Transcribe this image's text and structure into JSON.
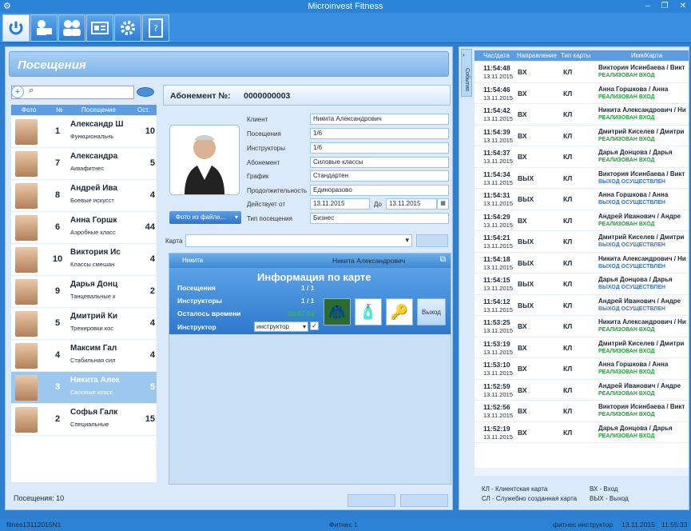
{
  "window": {
    "title": "Microinvest Fitness"
  },
  "toolbar": {
    "buttons": [
      "power-icon",
      "lock-user-icon",
      "users-icon",
      "card-icon",
      "gear-icon",
      "calculator-icon"
    ]
  },
  "section": {
    "title": "Посещения"
  },
  "visits_table": {
    "headers": {
      "photo": "Фото",
      "num": "№",
      "visit": "Посещение",
      "rest": "Ост."
    },
    "rows": [
      {
        "num": "1",
        "name": "Александр Ш",
        "activity": "Функциональнь",
        "count": "10",
        "selected": false
      },
      {
        "num": "7",
        "name": "Александра",
        "activity": "Аквафитнес",
        "count": "5",
        "selected": false
      },
      {
        "num": "8",
        "name": "Андрей Ива",
        "activity": "Боевые искусст",
        "count": "4",
        "selected": false
      },
      {
        "num": "6",
        "name": "Анна Горшк",
        "activity": "Аэробные класс",
        "count": "44",
        "selected": false
      },
      {
        "num": "10",
        "name": "Виктория Ис",
        "activity": "Классы смешан",
        "count": "4",
        "selected": false
      },
      {
        "num": "9",
        "name": "Дарья Донц",
        "activity": "Танцевальные к",
        "count": "2",
        "selected": false
      },
      {
        "num": "5",
        "name": "Дмитрий Ки",
        "activity": "Тренировки кос",
        "count": "4",
        "selected": false
      },
      {
        "num": "4",
        "name": "Максим Гал",
        "activity": "Стабильная сил",
        "count": "4",
        "selected": false
      },
      {
        "num": "3",
        "name": "Никита Алек",
        "activity": "Силовые класс",
        "count": "5",
        "selected": true
      },
      {
        "num": "2",
        "name": "Софья Галк",
        "activity": "Специальные",
        "count": "15",
        "selected": false
      }
    ],
    "footer": "Посещения: 10"
  },
  "abonement": {
    "label": "Абонемент №:",
    "number": "0000000003",
    "photo_button": "Фото из файла...",
    "fields": {
      "client": {
        "label": "Клиент",
        "value": "Никита Александрович"
      },
      "visits": {
        "label": "Посещения",
        "value": "1/6"
      },
      "instructors": {
        "label": "Инструкторы",
        "value": "1/6"
      },
      "abonement": {
        "label": "Абонемент",
        "value": "Силовые классы"
      },
      "schedule": {
        "label": "График",
        "value": "Стандартен"
      },
      "duration": {
        "label": "Продолжительность",
        "value": "Единоразово"
      },
      "valid_from": {
        "label": "Действует от",
        "value": "13.11.2015"
      },
      "valid_to": {
        "label": "До",
        "value": "13.11.2015"
      },
      "visit_type": {
        "label": "Тип посещения",
        "value": "Бизнес"
      }
    },
    "card_label": "Карта"
  },
  "card_panel": {
    "head_left": "Никита",
    "head_right": "Никита Александрович",
    "title": "Информация по карте",
    "visits_label": "Посещения",
    "visits_value": "1 / 1",
    "instructors_label": "Инструкторы",
    "instructors_value": "1 / 1",
    "time_left_label": "Осталось времени",
    "time_left_value": "00:07:51",
    "instructor_label": "Инструктор",
    "instructor_select": "инструктор",
    "exit_button": "Выход"
  },
  "events": {
    "side_tab": "События",
    "headers": {
      "time": "Час/дата",
      "dir": "Направление",
      "type": "Тип карты",
      "name": "Имя/Карта"
    },
    "rows": [
      {
        "time": "11:54:48",
        "date": "13.11.2015",
        "dir": "ВХ",
        "type": "КЛ",
        "name": "Виктория Исинбаева / Викт",
        "status": "РЕАЛИЗОВАН ВХОД",
        "out": false
      },
      {
        "time": "11:54:46",
        "date": "13.11.2015",
        "dir": "ВХ",
        "type": "КЛ",
        "name": "Анна Горшкова / Анна",
        "status": "РЕАЛИЗОВАН ВХОД",
        "out": false
      },
      {
        "time": "11:54:42",
        "date": "13.11.2015",
        "dir": "ВХ",
        "type": "КЛ",
        "name": "Никита Александрович / Ни",
        "status": "РЕАЛИЗОВАН ВХОД",
        "out": false
      },
      {
        "time": "11:54:39",
        "date": "13.11.2015",
        "dir": "ВХ",
        "type": "КЛ",
        "name": "Дмитрий Киселев / Дмитри",
        "status": "РЕАЛИЗОВАН ВХОД",
        "out": false
      },
      {
        "time": "11:54:37",
        "date": "13.11.2015",
        "dir": "ВХ",
        "type": "КЛ",
        "name": "Дарья Донцова / Дарья",
        "status": "РЕАЛИЗОВАН ВХОД",
        "out": false
      },
      {
        "time": "11:54:34",
        "date": "13.11.2015",
        "dir": "ВЫХ",
        "type": "КЛ",
        "name": "Виктория Исинбаева / Викт",
        "status": "ВЫХОД ОСУЩЕСТВЛЕН",
        "out": true
      },
      {
        "time": "11:54:31",
        "date": "13.11.2015",
        "dir": "ВЫХ",
        "type": "КЛ",
        "name": "Анна Горшкова / Анна",
        "status": "ВЫХОД ОСУЩЕСТВЛЕН",
        "out": true
      },
      {
        "time": "11:54:29",
        "date": "13.11.2015",
        "dir": "ВХ",
        "type": "КЛ",
        "name": "Андрей Иванович / Андре",
        "status": "РЕАЛИЗОВАН ВХОД",
        "out": false
      },
      {
        "time": "11:54:21",
        "date": "13.11.2015",
        "dir": "ВЫХ",
        "type": "КЛ",
        "name": "Дмитрий Киселев / Дмитри",
        "status": "ВЫХОД ОСУЩЕСТВЛЕН",
        "out": true
      },
      {
        "time": "11:54:18",
        "date": "13.11.2015",
        "dir": "ВЫХ",
        "type": "КЛ",
        "name": "Никита Александрович / Ни",
        "status": "ВЫХОД ОСУЩЕСТВЛЕН",
        "out": true
      },
      {
        "time": "11:54:15",
        "date": "13.11.2015",
        "dir": "ВЫХ",
        "type": "КЛ",
        "name": "Дарья Донцова / Дарья",
        "status": "ВЫХОД ОСУЩЕСТВЛЕН",
        "out": true
      },
      {
        "time": "11:54:12",
        "date": "13.11.2015",
        "dir": "ВЫХ",
        "type": "КЛ",
        "name": "Андрей Иванович / Андре",
        "status": "ВЫХОД ОСУЩЕСТВЛЕН",
        "out": true
      },
      {
        "time": "11:53:25",
        "date": "13.11.2015",
        "dir": "ВХ",
        "type": "КЛ",
        "name": "Никита Александрович / Ни",
        "status": "РЕАЛИЗОВАН ВХОД",
        "out": false
      },
      {
        "time": "11:53:19",
        "date": "13.11.2015",
        "dir": "ВХ",
        "type": "КЛ",
        "name": "Дмитрий Киселев / Дмитри",
        "status": "РЕАЛИЗОВАН ВХОД",
        "out": false
      },
      {
        "time": "11:53:10",
        "date": "13.11.2015",
        "dir": "ВХ",
        "type": "КЛ",
        "name": "Анна Горшкова / Анна",
        "status": "РЕАЛИЗОВАН ВХОД",
        "out": false
      },
      {
        "time": "11:52:59",
        "date": "13.11.2015",
        "dir": "ВХ",
        "type": "КЛ",
        "name": "Андрей Иванович / Андре",
        "status": "РЕАЛИЗОВАН ВХОД",
        "out": false
      },
      {
        "time": "11:52:56",
        "date": "13.11.2015",
        "dir": "ВХ",
        "type": "КЛ",
        "name": "Виктория Исинбаева / Викт",
        "status": "РЕАЛИЗОВАН ВХОД",
        "out": false
      },
      {
        "time": "11:52:19",
        "date": "13.11.2015",
        "dir": "ВХ",
        "type": "КЛ",
        "name": "Дарья Донцова / Дарья",
        "status": "РЕАЛИЗОВАН ВХОД",
        "out": false
      }
    ],
    "legend": {
      "kl": "КЛ - Клиентская карта",
      "sl": "СЛ - Служебно созданная карта",
      "vh": "ВХ - Вход",
      "vyh": "ВЫХ - Выход"
    }
  },
  "statusbar": {
    "left": "fitnes13112015N1",
    "center": "Фитнес 1",
    "user": "фитнес инструктор",
    "date": "13.11.2015",
    "time": "11:55:33"
  },
  "colors": {
    "accent": "#2b83d8",
    "in_status": "#22a03a",
    "out_status": "#3a74c8",
    "selected_row": "#9cc8ef"
  }
}
